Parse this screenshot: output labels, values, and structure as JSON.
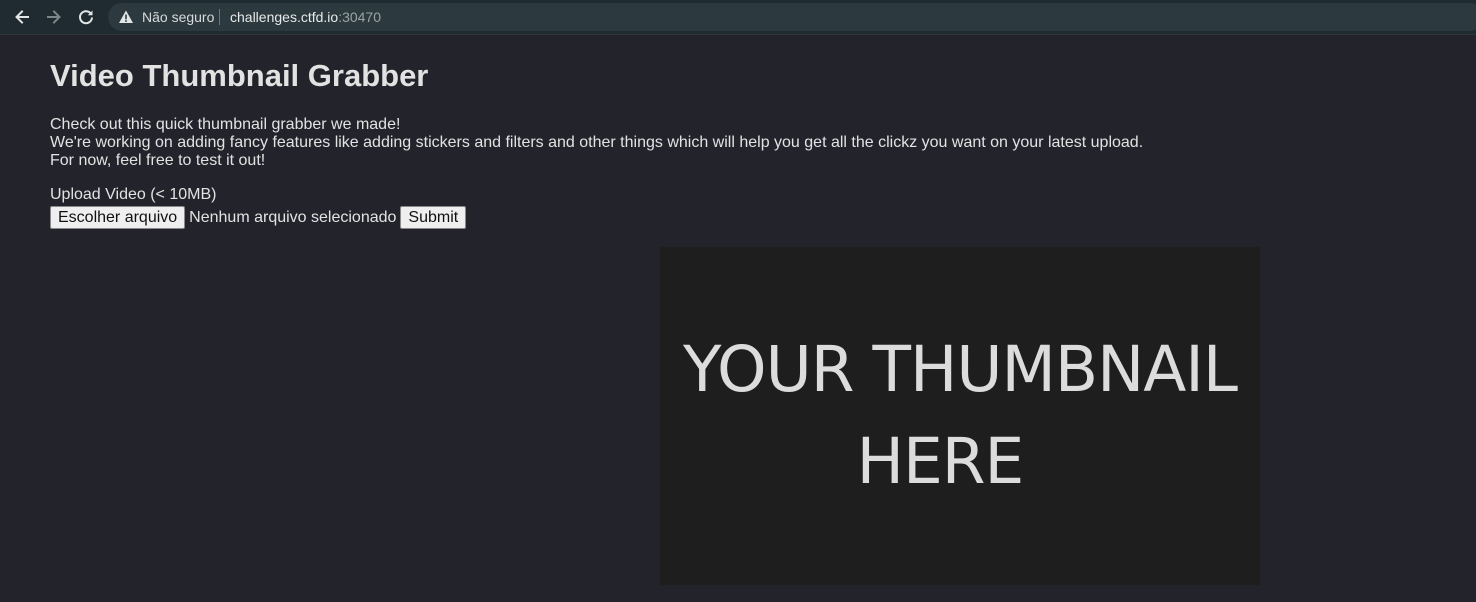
{
  "browser": {
    "security_label": "Não seguro",
    "url_host": "challenges.ctfd.io",
    "url_port": ":30470",
    "icons": [
      "back-arrow-icon",
      "forward-arrow-icon",
      "reload-icon",
      "warning-icon"
    ]
  },
  "page": {
    "title": "Video Thumbnail Grabber",
    "intro": [
      "Check out this quick thumbnail grabber we made!",
      "We're working on adding fancy features like adding stickers and filters and other things which will help you get all the clickz you want on your latest upload.",
      "For now, feel free to test it out!"
    ],
    "upload_label": "Upload Video (< 10MB)",
    "choose_file_label": "Escolher arquivo",
    "no_file_text": "Nenhum arquivo selecionado",
    "submit_label": "Submit",
    "thumbnail_lines": [
      "YOUR THUMBNAIL",
      "HERE"
    ]
  },
  "colors": {
    "page_background": "#23242b",
    "toolbar_background": "#1f2b30",
    "thumbnail_background": "#1e1e1f",
    "text": "#e2e2e2"
  }
}
